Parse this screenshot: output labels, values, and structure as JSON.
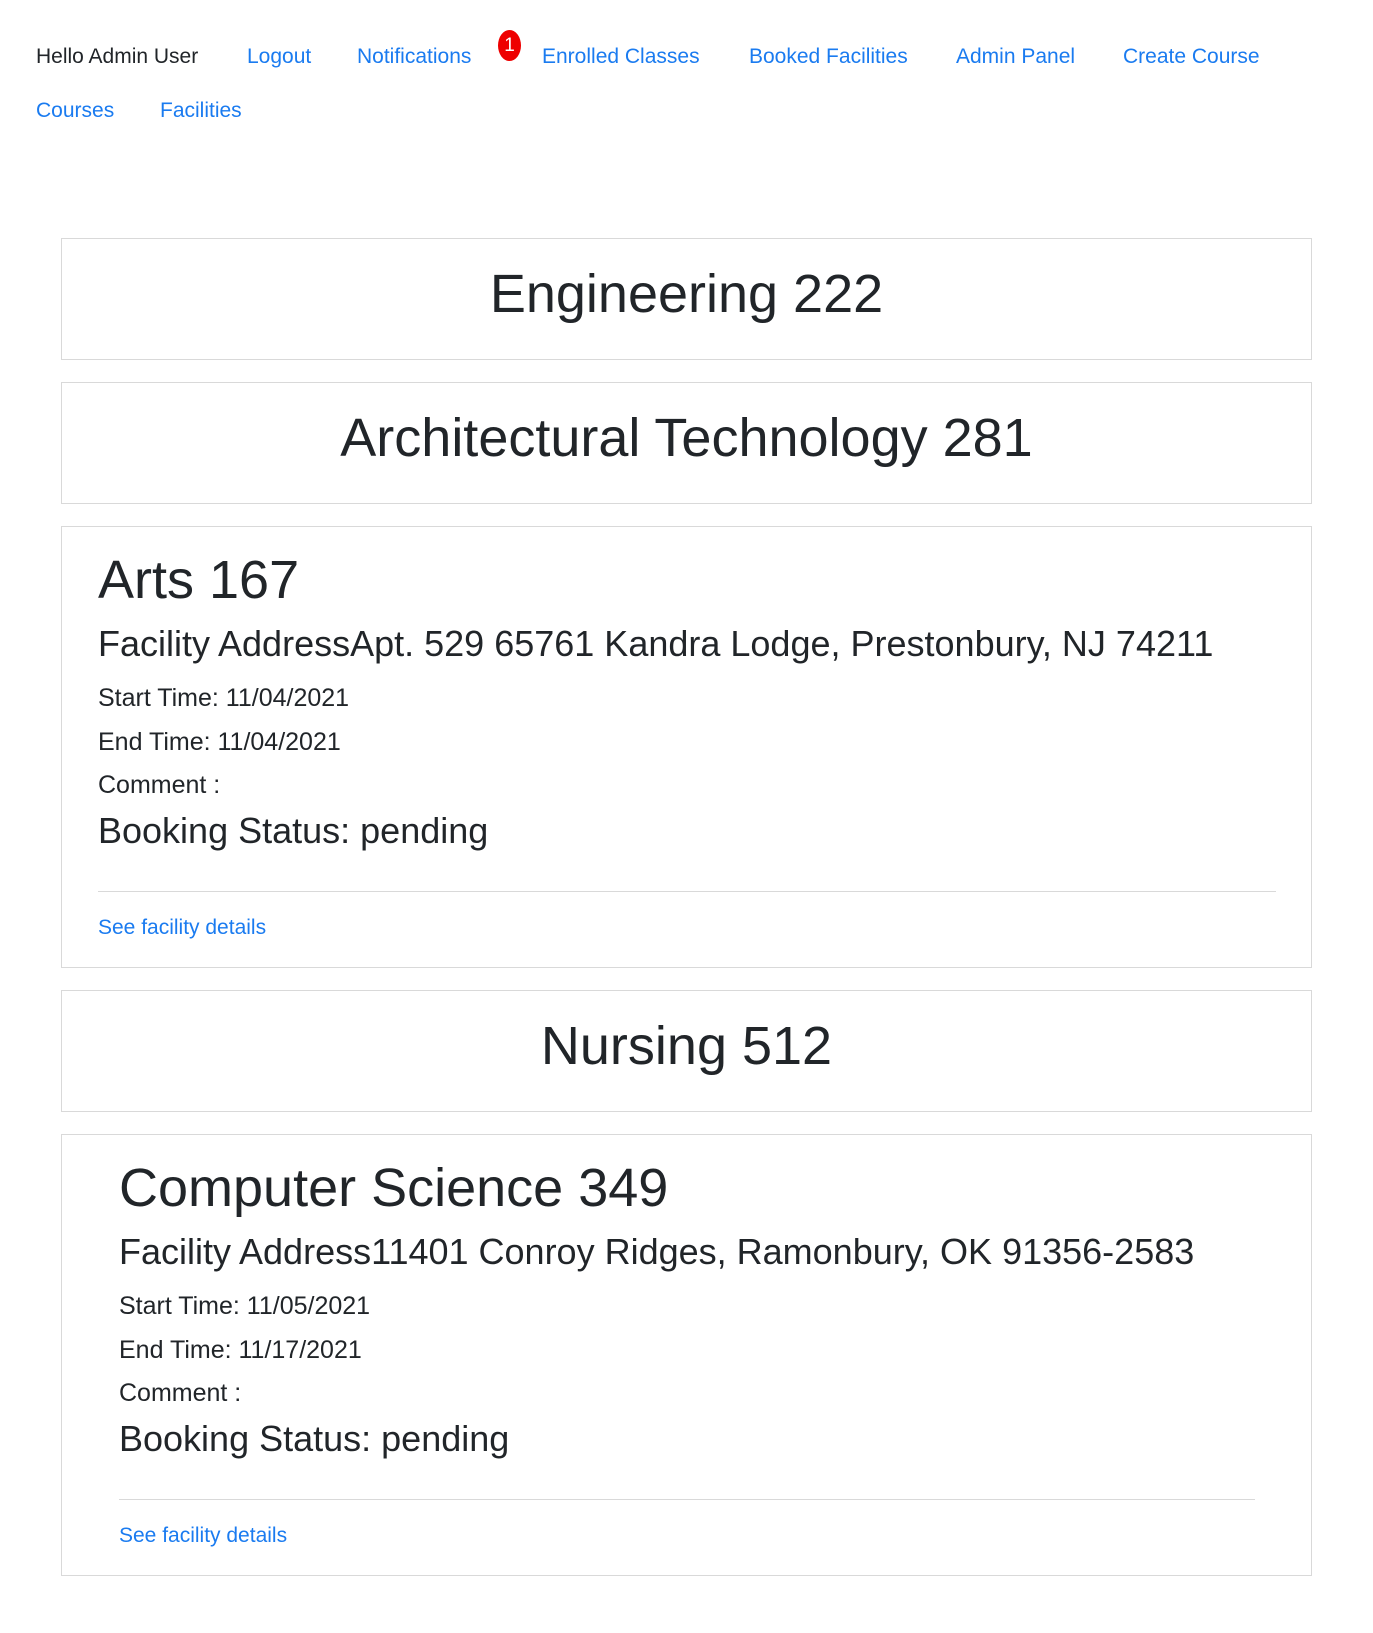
{
  "nav": {
    "greeting": "Hello Admin User",
    "logout": "Logout",
    "notifications": "Notifications",
    "notification_count": "1",
    "enrolled_classes": "Enrolled Classes",
    "booked_facilities": "Booked Facilities",
    "admin_panel": "Admin Panel",
    "create_course": "Create Course",
    "courses": "Courses",
    "facilities": "Facilities"
  },
  "bookings": [
    {
      "title": "Engineering 222"
    },
    {
      "title": "Architectural Technology 281"
    },
    {
      "title": "Arts 167",
      "address": "Facility AddressApt. 529 65761 Kandra Lodge, Prestonbury, NJ 74211",
      "start_time": "Start Time: 11/04/2021",
      "end_time": "End Time: 11/04/2021",
      "comment": "Comment :",
      "status": "Booking Status: pending",
      "link": "See facility details"
    },
    {
      "title": "Nursing 512"
    },
    {
      "title": "Computer Science 349",
      "address": "Facility Address11401 Conroy Ridges, Ramonbury, OK 91356-2583",
      "start_time": "Start Time: 11/05/2021",
      "end_time": "End Time: 11/17/2021",
      "comment": "Comment :",
      "status": "Booking Status: pending",
      "link": "See facility details"
    }
  ],
  "colors": {
    "link": "#1a7bf0",
    "text": "#212529",
    "badge": "#ee0000",
    "border": "#d9d9d9"
  }
}
